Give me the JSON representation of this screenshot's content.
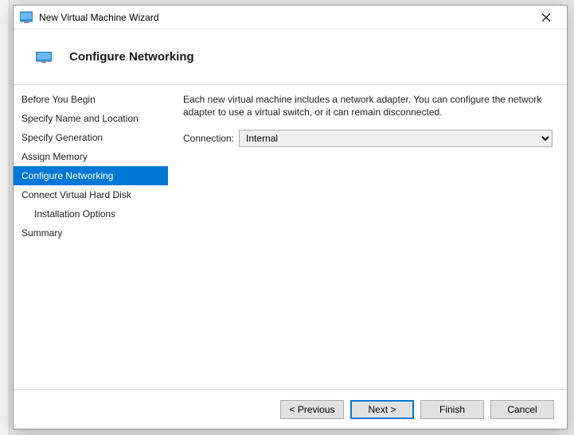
{
  "titlebar": {
    "title": "New Virtual Machine Wizard"
  },
  "header": {
    "page_title": "Configure Networking"
  },
  "sidebar": {
    "steps": [
      {
        "label": "Before You Begin",
        "indent": false,
        "selected": false
      },
      {
        "label": "Specify Name and Location",
        "indent": false,
        "selected": false
      },
      {
        "label": "Specify Generation",
        "indent": false,
        "selected": false
      },
      {
        "label": "Assign Memory",
        "indent": false,
        "selected": false
      },
      {
        "label": "Configure Networking",
        "indent": false,
        "selected": true
      },
      {
        "label": "Connect Virtual Hard Disk",
        "indent": false,
        "selected": false
      },
      {
        "label": "Installation Options",
        "indent": true,
        "selected": false
      },
      {
        "label": "Summary",
        "indent": false,
        "selected": false
      }
    ]
  },
  "content": {
    "description": "Each new virtual machine includes a network adapter. You can configure the network adapter to use a virtual switch, or it can remain disconnected.",
    "connection_label": "Connection:",
    "connection_value": "Internal"
  },
  "footer": {
    "previous": "< Previous",
    "next": "Next >",
    "finish": "Finish",
    "cancel": "Cancel"
  }
}
